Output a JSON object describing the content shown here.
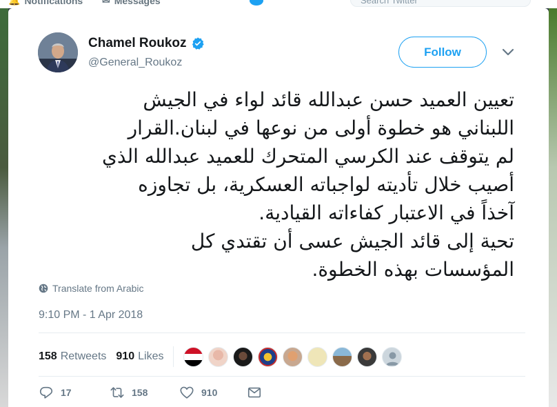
{
  "background": {
    "nav_notifications": "Notifications",
    "nav_messages": "Messages",
    "search_placeholder": "Search Twitter"
  },
  "tweet": {
    "author_name": "Chamel Roukoz",
    "author_handle": "@General_Roukoz",
    "verified": true,
    "follow_label": "Follow",
    "text": "تعيين العميد حسن عبدالله قائد لواء في الجيش\nاللبناني هو خطوة أولى من نوعها في لبنان.القرار\nلم يتوقف عند الكرسي المتحرك للعميد عبدالله الذي\nأصيب خلال تأديته لواجباته العسكرية، بل تجاوزه\nآخذاً في الاعتبار كفاءاته القيادية.\nتحية إلى قائد الجيش عسى أن تقتدي كل\nالمؤسسات بهذه الخطوة.",
    "translate_label": "Translate from Arabic",
    "timestamp": "9:10 PM - 1 Apr 2018",
    "retweets_count": "158",
    "retweets_label": "Retweets",
    "likes_count": "910",
    "likes_label": "Likes",
    "actions": {
      "replies": "17",
      "retweets": "158",
      "likes": "910"
    }
  },
  "colors": {
    "accent": "#1da1f2",
    "text": "#14171a",
    "muted": "#657786"
  }
}
